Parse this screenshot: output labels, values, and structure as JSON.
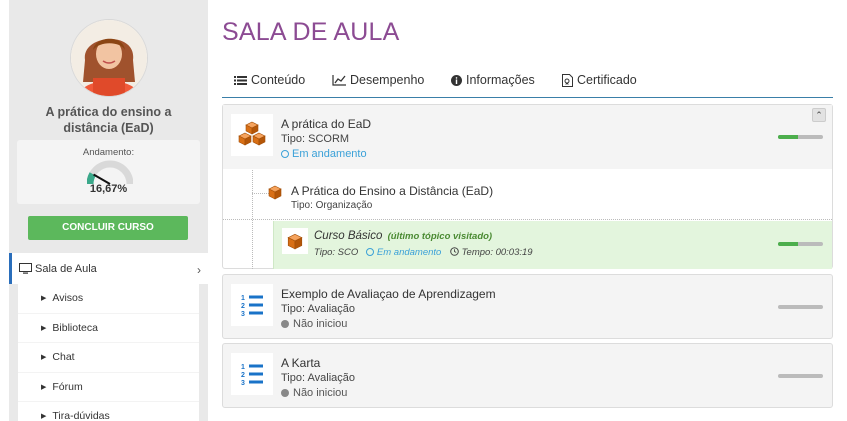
{
  "sidebar": {
    "course_title": "A prática do ensino a distância (EaD)",
    "progress_label": "Andamento:",
    "progress_value": "16,67%",
    "progress_fraction": 0.1667,
    "complete_button": "CONCLUIR CURSO",
    "nav_main_label": "Sala de Aula",
    "nav_items": [
      {
        "label": "Avisos"
      },
      {
        "label": "Biblioteca"
      },
      {
        "label": "Chat"
      },
      {
        "label": "Fórum"
      },
      {
        "label": "Tira-dúvidas"
      }
    ]
  },
  "main": {
    "page_title": "SALA DE AULA",
    "tabs": [
      {
        "label": "Conteúdo",
        "icon": "list-icon"
      },
      {
        "label": "Desempenho",
        "icon": "line-chart-icon"
      },
      {
        "label": "Informações",
        "icon": "info-icon"
      },
      {
        "label": "Certificado",
        "icon": "certificate-icon"
      }
    ],
    "items": [
      {
        "title": "A prática do EaD",
        "type": "Tipo: SCORM",
        "status": "Em andamento",
        "progress": 0.45,
        "icon": "cubes-icon",
        "organization": {
          "title": "A Prática do Ensino a Distância (EaD)",
          "type": "Tipo: Organização",
          "icon": "cube-icon"
        },
        "sco": {
          "title": "Curso Básico",
          "last_visited": "(último tópico visitado)",
          "type": "Tipo: SCO",
          "status": "Em andamento",
          "time": "Tempo: 00:03:19",
          "progress": 0.45,
          "icon": "cube-icon"
        }
      },
      {
        "title": "Exemplo de Avaliaçao de Aprendizagem",
        "type": "Tipo: Avaliação",
        "status": "Não iniciou",
        "progress": 0,
        "icon": "numbered-list-icon"
      },
      {
        "title": "A Karta",
        "type": "Tipo: Avaliação",
        "status": "Não iniciou",
        "progress": 0,
        "icon": "numbered-list-icon"
      }
    ]
  },
  "colors": {
    "title_purple": "#8c4b93",
    "button_green": "#5cb85c",
    "status_blue": "#3ba1d8",
    "highlight_green": "#e3f5dd",
    "tab_underline": "#3a7fa8"
  }
}
